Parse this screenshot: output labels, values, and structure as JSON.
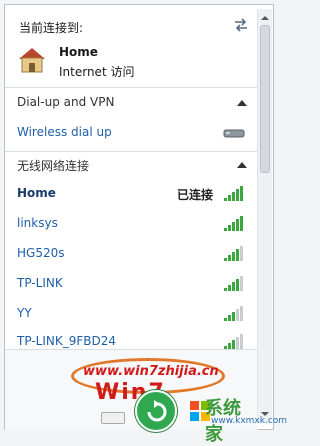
{
  "header": {
    "title": "当前连接到:",
    "network_name": "Home",
    "network_status": "Internet 访问"
  },
  "sections": {
    "dialup": {
      "label": "Dial-up and VPN",
      "items": [
        {
          "label": "Wireless dial up"
        }
      ]
    },
    "wireless": {
      "label": "无线网络连接"
    }
  },
  "networks": [
    {
      "name": "Home",
      "status": "已连接",
      "signal": 5
    },
    {
      "name": "linksys",
      "signal": 5
    },
    {
      "name": "HG520s",
      "signal": 4
    },
    {
      "name": "TP-LINK",
      "signal": 4
    },
    {
      "name": "YY",
      "signal": 3
    },
    {
      "name": "TP-LINK_9FBD24",
      "signal": 3
    }
  ],
  "watermark": {
    "url_text": "www.win7zhijia.cn",
    "logo_text": "Win7",
    "brand": "系统家",
    "brand_url": "www.kxmxk.com"
  },
  "colors": {
    "accent": "#1f5fa8",
    "signal": "#3ca640",
    "oval": "#e07a2a",
    "watermark": "#d11a1a"
  }
}
